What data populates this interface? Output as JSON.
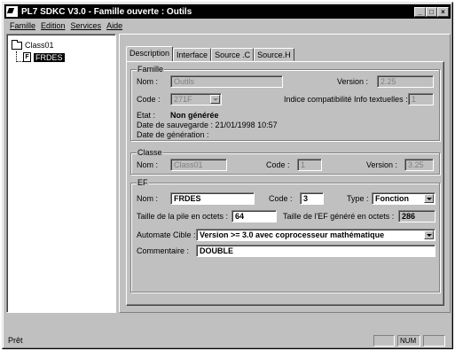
{
  "window": {
    "title": "PL7 SDKC V3.0 - Famille ouverte : Outils"
  },
  "menu": [
    "Famille",
    "Edition",
    "Services",
    "Aide"
  ],
  "tree": {
    "root": "Class01",
    "child": "FRDES"
  },
  "tabs": [
    "Description",
    "Interface",
    "Source .C",
    "Source.H"
  ],
  "famille": {
    "legend": "Famille",
    "nom_label": "Nom :",
    "nom_value": "Outils",
    "version_label": "Version :",
    "version_value": "2.25",
    "code_label": "Code :",
    "code_value": "271F",
    "indice_label": "Indice compatibilité Info textuelles :",
    "indice_value": "1",
    "etat_label": "Etat :",
    "etat_value": "Non générée",
    "sauvegarde": "Date de sauvegarde : 21/01/1998 10:57",
    "generation": "Date de génération :"
  },
  "classe": {
    "legend": "Classe",
    "nom_label": "Nom :",
    "nom_value": "Class01",
    "code_label": "Code :",
    "code_value": "1",
    "version_label": "Version :",
    "version_value": "3.25"
  },
  "ef": {
    "legend": "EF",
    "nom_label": "Nom :",
    "nom_value": "FRDES",
    "code_label": "Code :",
    "code_value": "3",
    "type_label": "Type :",
    "type_value": "Fonction",
    "pile_label": "Taille de la pile en octets :",
    "pile_value": "64",
    "taille_label": "Taille de l'EF généré en octets :",
    "taille_value": "286",
    "automate_label": "Automate Cible :",
    "automate_value": "Version >= 3.0 avec  coprocesseur mathématique",
    "commentaire_label": "Commentaire :",
    "commentaire_value": "DOUBLE"
  },
  "status": {
    "text": "Prêt",
    "num": "NUM"
  },
  "title_buttons": [
    "_",
    "□",
    "×"
  ]
}
